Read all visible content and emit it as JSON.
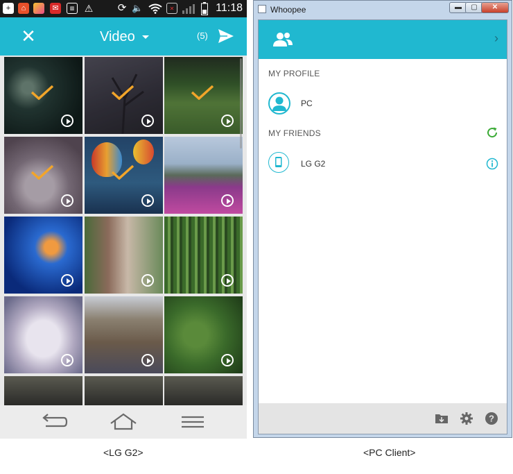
{
  "phone": {
    "status_bar": {
      "time": "11:18",
      "icons": [
        "add-icon",
        "home-icon",
        "photo-icon",
        "mail-icon",
        "sd-card-icon",
        "warning-icon",
        "sync-icon",
        "volume-icon",
        "wifi-icon",
        "no-sim-icon",
        "signal-icon",
        "battery-icon"
      ]
    },
    "app_bar": {
      "close_label": "✕",
      "title": "Video",
      "selected_count": "(5)"
    },
    "thumbnails": [
      {
        "scene": "sea-creature",
        "selected": true
      },
      {
        "scene": "blossom-tree",
        "selected": true
      },
      {
        "scene": "green-fields",
        "selected": true
      },
      {
        "scene": "kitten",
        "selected": true
      },
      {
        "scene": "balloons",
        "selected": true
      },
      {
        "scene": "flower-hills",
        "selected": false
      },
      {
        "scene": "aquarium",
        "selected": false
      },
      {
        "scene": "stone-wall-street",
        "selected": false
      },
      {
        "scene": "bamboo",
        "selected": false
      },
      {
        "scene": "white-vase",
        "selected": false
      },
      {
        "scene": "market-crowd",
        "selected": false
      },
      {
        "scene": "pine-forest",
        "selected": false
      }
    ],
    "nav_icons": [
      "back-icon",
      "home-icon",
      "menu-icon"
    ],
    "caption": "<LG G2>"
  },
  "pc": {
    "window_title": "Whoopee",
    "window_buttons": [
      "minimize-icon",
      "maximize-icon",
      "close-icon"
    ],
    "sections": {
      "profile": "MY PROFILE",
      "friends": "MY FRIENDS"
    },
    "profile_name": "PC",
    "friend_name": "LG G2",
    "caption": "<PC Client>"
  },
  "colors": {
    "accent": "#20b8d0",
    "check": "#f2a52a",
    "refresh": "#3aaa35",
    "footer": "#e4e4e4"
  }
}
